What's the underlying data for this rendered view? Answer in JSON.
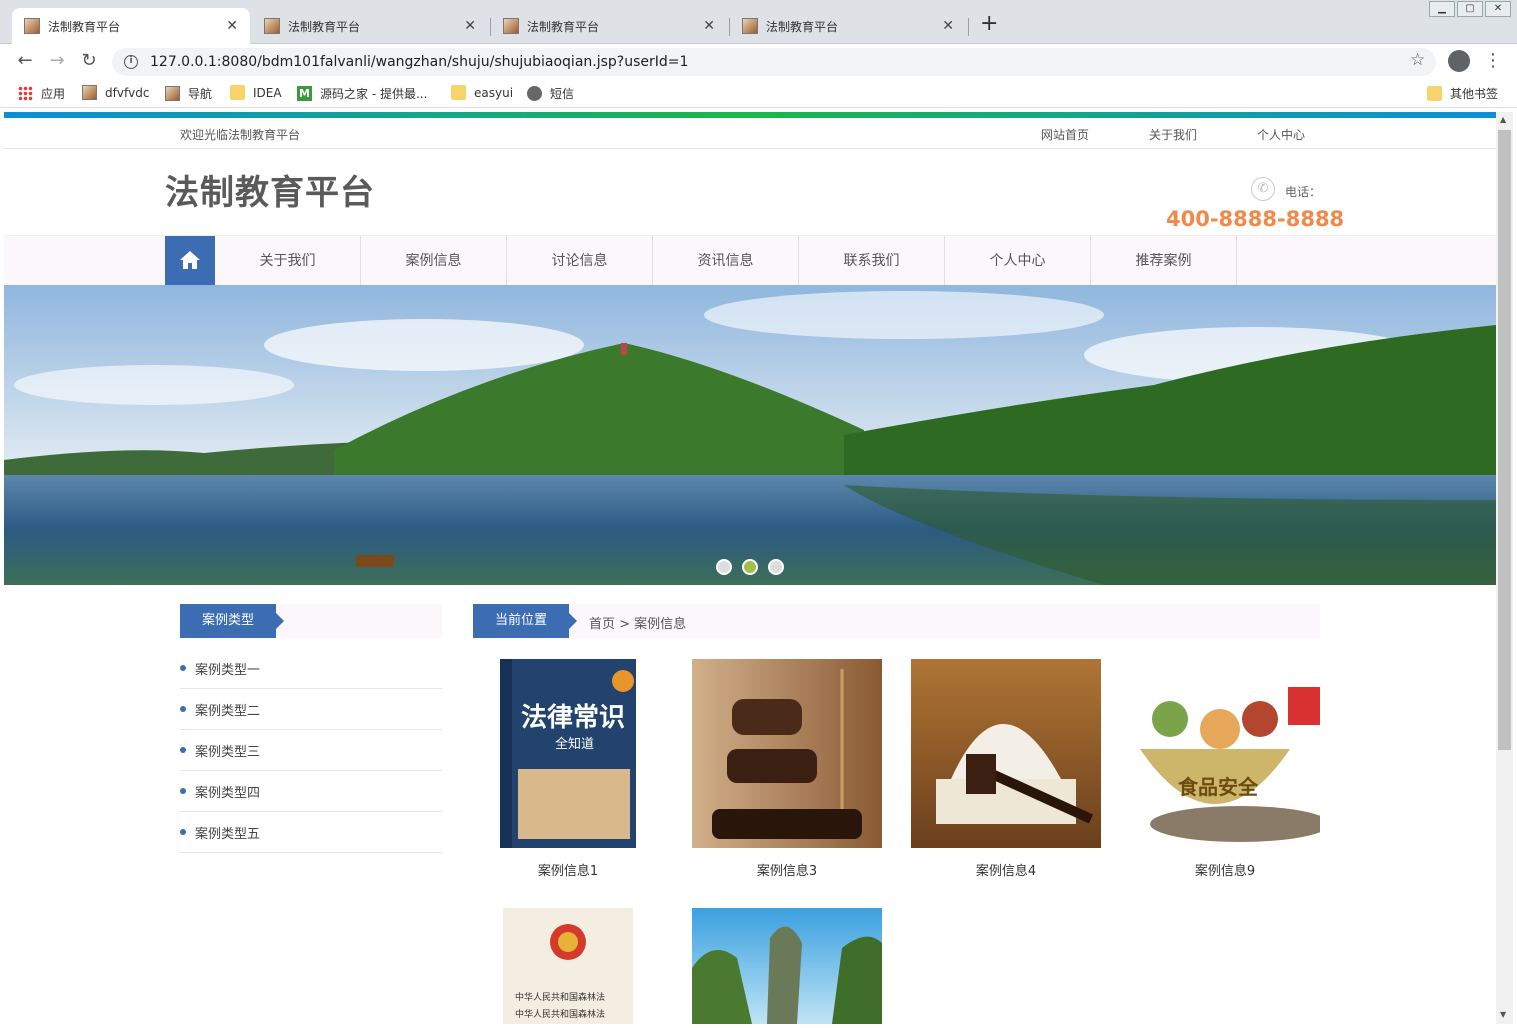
{
  "browser": {
    "tabs": [
      {
        "title": "法制教育平台",
        "active": true
      },
      {
        "title": "法制教育平台",
        "active": false
      },
      {
        "title": "法制教育平台",
        "active": false
      },
      {
        "title": "法制教育平台",
        "active": false
      }
    ],
    "url": "127.0.0.1:8080/bdm101falvanli/wangzhan/shuju/shujubiaoqian.jsp?userId=1",
    "bookmarks": [
      {
        "label": "应用",
        "icon": "apps-icon"
      },
      {
        "label": "dfvfvdc",
        "icon": "image-icon"
      },
      {
        "label": "导航",
        "icon": "image-icon"
      },
      {
        "label": "IDEA",
        "icon": "folder-icon"
      },
      {
        "label": "源码之家 - 提供最...",
        "icon": "m-icon"
      },
      {
        "label": "easyui",
        "icon": "folder-icon"
      },
      {
        "label": "短信",
        "icon": "globe-icon"
      }
    ],
    "other_bookmarks": "其他书签"
  },
  "site": {
    "welcome": "欢迎光临法制教育平台",
    "top_links": [
      "网站首页",
      "关于我们",
      "个人中心"
    ],
    "logo": "法制教育平台",
    "phone_label": "电话：",
    "phone_number": "400-8888-8888",
    "nav": [
      "关于我们",
      "案例信息",
      "讨论信息",
      "资讯信息",
      "联系我们",
      "个人中心",
      "推荐案例"
    ],
    "accent": "#3c6db3"
  },
  "sidebar": {
    "title": "案例类型",
    "items": [
      "案例类型一",
      "案例类型二",
      "案例类型三",
      "案例类型四",
      "案例类型五"
    ]
  },
  "breadcrumb": {
    "title": "当前位置",
    "path": "首页 > 案例信息"
  },
  "cards": [
    {
      "caption": "案例信息1",
      "book_title": "法律常识",
      "book_sub": "全知道"
    },
    {
      "caption": "案例信息3"
    },
    {
      "caption": "案例信息4"
    },
    {
      "caption": "案例信息9",
      "bowl_text": "食品安全"
    },
    {
      "caption": "",
      "book_lines": [
        "中华人民共和国森林法",
        "中华人民共和国森林法"
      ]
    },
    {
      "caption": ""
    }
  ]
}
